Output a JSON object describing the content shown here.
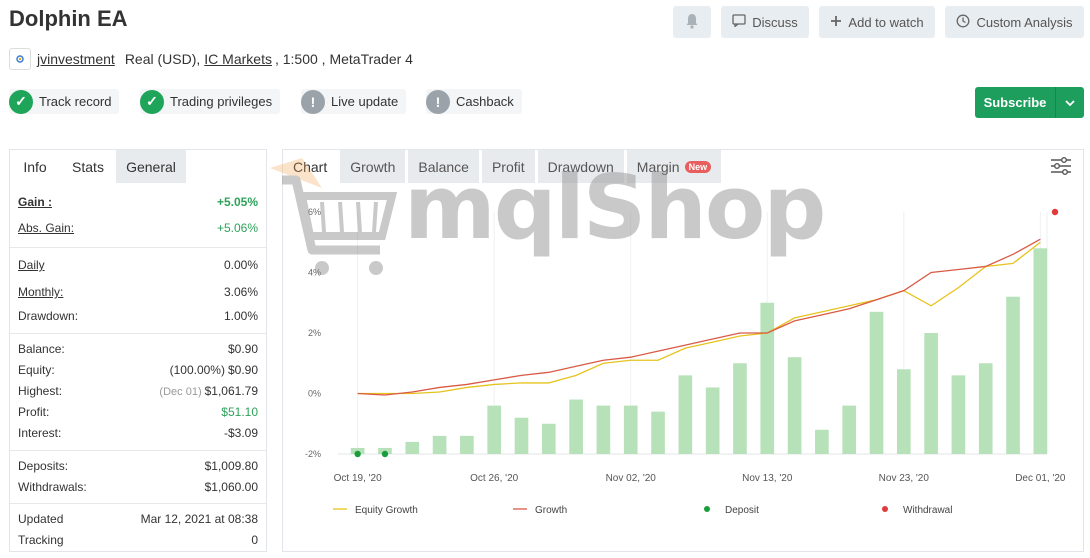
{
  "header": {
    "title": "Dolphin EA",
    "buttons": {
      "discuss": "Discuss",
      "watch": "Add to watch",
      "custom": "Custom Analysis"
    }
  },
  "account": {
    "user": "jvinvestment",
    "type": "Real (USD),",
    "broker": "IC Markets",
    "leverage": ", 1:500 , MetaTrader 4"
  },
  "badges": [
    "Track record",
    "Trading privileges",
    "Live update",
    "Cashback"
  ],
  "subscribe_label": "Subscribe",
  "left_tabs": [
    "Info",
    "Stats",
    "General"
  ],
  "stats": {
    "gain": {
      "label": "Gain :",
      "value": "+5.05%"
    },
    "abs_gain": {
      "label": "Abs. Gain:",
      "value": "+5.06%"
    },
    "daily": {
      "label": "Daily",
      "value": "0.00%"
    },
    "monthly": {
      "label": "Monthly:",
      "value": "3.06%"
    },
    "drawdown": {
      "label": "Drawdown:",
      "value": "1.00%"
    },
    "balance": {
      "label": "Balance:",
      "value": "$0.90"
    },
    "equity": {
      "label": "Equity:",
      "note": "(100.00%)",
      "value": "$0.90"
    },
    "highest": {
      "label": "Highest:",
      "note": "(Dec 01)",
      "value": "$1,061.79"
    },
    "profit": {
      "label": "Profit:",
      "value": "$51.10"
    },
    "interest": {
      "label": "Interest:",
      "value": "-$3.09"
    },
    "deposits": {
      "label": "Deposits:",
      "value": "$1,009.80"
    },
    "withdrawals": {
      "label": "Withdrawals:",
      "value": "$1,060.00"
    },
    "updated": {
      "label": "Updated",
      "value": "Mar 12, 2021 at 08:38"
    },
    "tracking": {
      "label": "Tracking",
      "value": "0"
    }
  },
  "right_tabs": [
    "Chart",
    "Growth",
    "Balance",
    "Profit",
    "Drawdown",
    "Margin"
  ],
  "new_pill": "New",
  "watermark": "mqlShop",
  "colors": {
    "green": "#1e9e5d",
    "bar": "#b7e1b9",
    "equity": "#e6c31d",
    "growth": "#d95a45",
    "deposit": "#1a9e3c",
    "withdrawal": "#e03a3a"
  },
  "chart_data": {
    "type": "line",
    "yticks": [
      "6%",
      "4%",
      "2%",
      "0%",
      "-2%"
    ],
    "ylim": [
      -2,
      6
    ],
    "x_tick_labels": [
      "Oct 19, '20",
      "Oct 26, '20",
      "Nov 02, '20",
      "Nov 13, '20",
      "Nov 23, '20",
      "Dec 01, '20"
    ],
    "x_tick_index": [
      0,
      5,
      10,
      15,
      20,
      25
    ],
    "bars": [
      -1.8,
      -1.8,
      -1.6,
      -1.4,
      -1.4,
      -0.4,
      -0.8,
      -1.0,
      -0.2,
      -0.4,
      -0.4,
      -0.6,
      0.6,
      0.2,
      1.0,
      3.0,
      1.2,
      -1.2,
      -0.4,
      2.7,
      0.8,
      2.0,
      0.6,
      1.0,
      3.2,
      4.8
    ],
    "series": [
      {
        "name": "Equity Growth",
        "values": [
          0.0,
          0.0,
          0.0,
          0.05,
          0.2,
          0.3,
          0.35,
          0.35,
          0.6,
          1.0,
          1.1,
          1.1,
          1.5,
          1.7,
          1.9,
          2.0,
          2.5,
          2.7,
          2.9,
          3.1,
          3.4,
          2.9,
          3.5,
          4.2,
          4.3,
          5.0
        ]
      },
      {
        "name": "Growth",
        "values": [
          0.0,
          -0.05,
          0.05,
          0.2,
          0.3,
          0.45,
          0.6,
          0.7,
          0.9,
          1.1,
          1.2,
          1.4,
          1.6,
          1.8,
          2.0,
          2.0,
          2.4,
          2.6,
          2.8,
          3.1,
          3.4,
          4.0,
          4.1,
          4.2,
          4.6,
          5.1
        ]
      }
    ],
    "deposits_index": [
      0,
      1
    ],
    "withdrawals_index": [
      26
    ],
    "legend": [
      "Equity Growth",
      "Growth",
      "Deposit",
      "Withdrawal"
    ]
  }
}
